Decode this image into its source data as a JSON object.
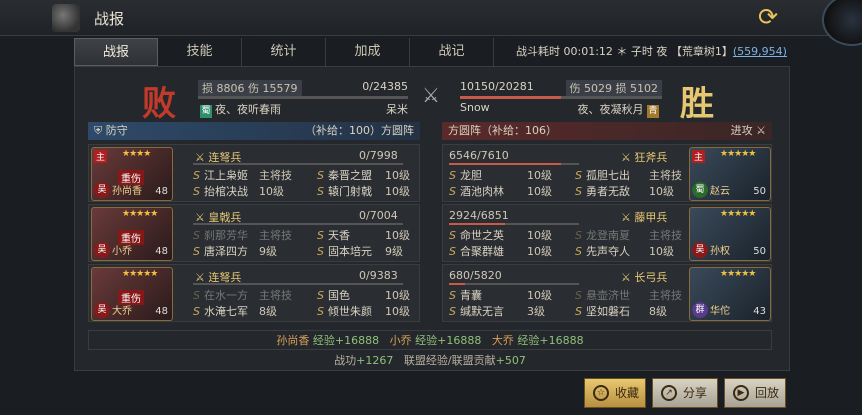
{
  "window": {
    "title": "战报"
  },
  "tabs": [
    {
      "label": "战报"
    },
    {
      "label": "技能"
    },
    {
      "label": "统计"
    },
    {
      "label": "加成"
    },
    {
      "label": "战记"
    }
  ],
  "battle_info": {
    "prefix": "战斗耗时 00:01:12 ＊ 子时 夜 【荒章树1】",
    "coord": "(559,954)"
  },
  "left": {
    "result": "败",
    "loss_label": "损",
    "loss": "8806",
    "dmg_label": "伤",
    "dmg": "15579",
    "troops": "0/24385",
    "troops_fraction": 0,
    "commander": "夜、夜听春雨",
    "badge": "蜀",
    "city": "呆米",
    "stance": "防守",
    "supply": "（补给：100）方圆阵",
    "generals": [
      {
        "tag": "主",
        "stars": "★★★★",
        "status": "重伤",
        "camp": "吴",
        "name": "孙尚香",
        "level": "48",
        "unit": "连弩兵",
        "count": "0/7998",
        "fill": 0,
        "skills": [
          {
            "name": "江上枭姬",
            "lvl": "主将技",
            "dim": false
          },
          {
            "name": "秦晋之盟",
            "lvl": "10级",
            "dim": false
          },
          {
            "name": "抬棺决战",
            "lvl": "10级",
            "dim": false
          },
          {
            "name": "辕门射戟",
            "lvl": "10级",
            "dim": false
          }
        ]
      },
      {
        "tag": "",
        "stars": "★★★★★",
        "status": "重伤",
        "camp": "吴",
        "name": "小乔",
        "level": "48",
        "unit": "皇戟兵",
        "count": "0/7004",
        "fill": 0,
        "skills": [
          {
            "name": "刹那芳华",
            "lvl": "主将技",
            "dim": true
          },
          {
            "name": "天香",
            "lvl": "10级",
            "dim": false
          },
          {
            "name": "唐泽四方",
            "lvl": "9级",
            "dim": false
          },
          {
            "name": "固本培元",
            "lvl": "9级",
            "dim": false
          }
        ]
      },
      {
        "tag": "",
        "stars": "★★★★★",
        "status": "重伤",
        "camp": "吴",
        "name": "大乔",
        "level": "48",
        "unit": "连弩兵",
        "count": "0/9383",
        "fill": 0,
        "skills": [
          {
            "name": "在水一方",
            "lvl": "主将技",
            "dim": true
          },
          {
            "name": "国色",
            "lvl": "10级",
            "dim": false
          },
          {
            "name": "水淹七军",
            "lvl": "8级",
            "dim": false
          },
          {
            "name": "倾世朱颜",
            "lvl": "10级",
            "dim": false
          }
        ]
      }
    ]
  },
  "right": {
    "result": "胜",
    "loss_label": "损",
    "loss": "5102",
    "dmg_label": "伤",
    "dmg": "5029",
    "troops": "10150/20281",
    "troops_fraction": 0.5,
    "commander": "夜、夜凝秋月",
    "badge": "青",
    "player": "Snow",
    "stance": "进攻",
    "supply": "方圆阵（补给：106）",
    "generals": [
      {
        "tag": "主",
        "stars": "★★★★★",
        "camp": "蜀",
        "name": "赵云",
        "level": "50",
        "unit": "狂斧兵",
        "count": "6546/7610",
        "fill": 0.86,
        "skills": [
          {
            "name": "龙胆",
            "lvl": "10级",
            "dim": false
          },
          {
            "name": "孤胆七出",
            "lvl": "主将技",
            "dim": false
          },
          {
            "name": "酒池肉林",
            "lvl": "10级",
            "dim": false
          },
          {
            "name": "勇者无敌",
            "lvl": "10级",
            "dim": false
          }
        ]
      },
      {
        "tag": "",
        "stars": "★★★★★",
        "camp": "吴",
        "name": "孙权",
        "level": "50",
        "unit": "藤甲兵",
        "count": "2924/6851",
        "fill": 0.43,
        "skills": [
          {
            "name": "命世之英",
            "lvl": "10级",
            "dim": false
          },
          {
            "name": "龙登南夏",
            "lvl": "主将技",
            "dim": true
          },
          {
            "name": "合聚群雄",
            "lvl": "10级",
            "dim": false
          },
          {
            "name": "先声夺人",
            "lvl": "10级",
            "dim": false
          }
        ]
      },
      {
        "tag": "",
        "stars": "★★★★★",
        "camp": "群",
        "name": "华佗",
        "level": "43",
        "unit": "长弓兵",
        "count": "680/5820",
        "fill": 0.12,
        "skills": [
          {
            "name": "青囊",
            "lvl": "10级",
            "dim": false
          },
          {
            "name": "悬壶济世",
            "lvl": "主将技",
            "dim": true
          },
          {
            "name": "缄默无言",
            "lvl": "3级",
            "dim": false
          },
          {
            "name": "坚如磐石",
            "lvl": "8级",
            "dim": false
          }
        ]
      }
    ]
  },
  "exp": {
    "items": [
      {
        "name": "孙尚香",
        "text": "经验+16888"
      },
      {
        "name": "小乔",
        "text": "经验+16888"
      },
      {
        "name": "大乔",
        "text": "经验+16888"
      }
    ]
  },
  "merit": {
    "label": "战功",
    "value": "+1267",
    "alliance_label": "联盟经验/联盟贡献",
    "alliance_value": "+507"
  },
  "buttons": {
    "fav": "收藏",
    "share": "分享",
    "replay": "回放"
  },
  "colors": {
    "accent": "#e6c873",
    "lose": "#c23a2a",
    "win": "#e6c873",
    "hp": "#c85a4a"
  }
}
